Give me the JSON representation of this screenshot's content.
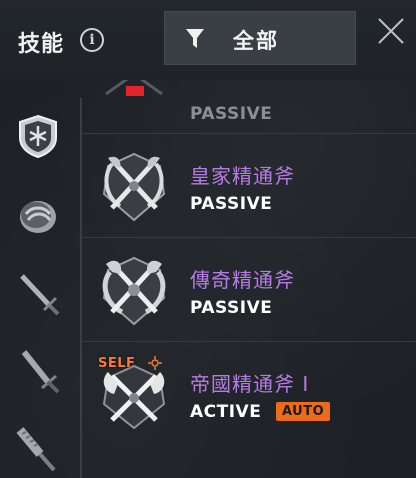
{
  "header": {
    "title": "技能",
    "filter_label": "全部"
  },
  "sidebar": {
    "tabs": [
      {
        "icon": "shield-icon",
        "selected": true
      },
      {
        "icon": "round-shield-icon"
      },
      {
        "icon": "sword-icon"
      },
      {
        "icon": "dagger-icon"
      },
      {
        "icon": "mace-icon"
      }
    ]
  },
  "skills": [
    {
      "name": "",
      "type": "PASSIVE"
    },
    {
      "name": "皇家精通斧",
      "type": "PASSIVE"
    },
    {
      "name": "傳奇精通斧",
      "type": "PASSIVE"
    },
    {
      "name": "帝國精通斧 I",
      "type": "ACTIVE",
      "badge": "AUTO",
      "self_label": "SELF"
    }
  ],
  "colors": {
    "skill_name": "#b57ce6",
    "auto_badge": "#ec6a1c",
    "self_label": "#ff7a2a"
  }
}
